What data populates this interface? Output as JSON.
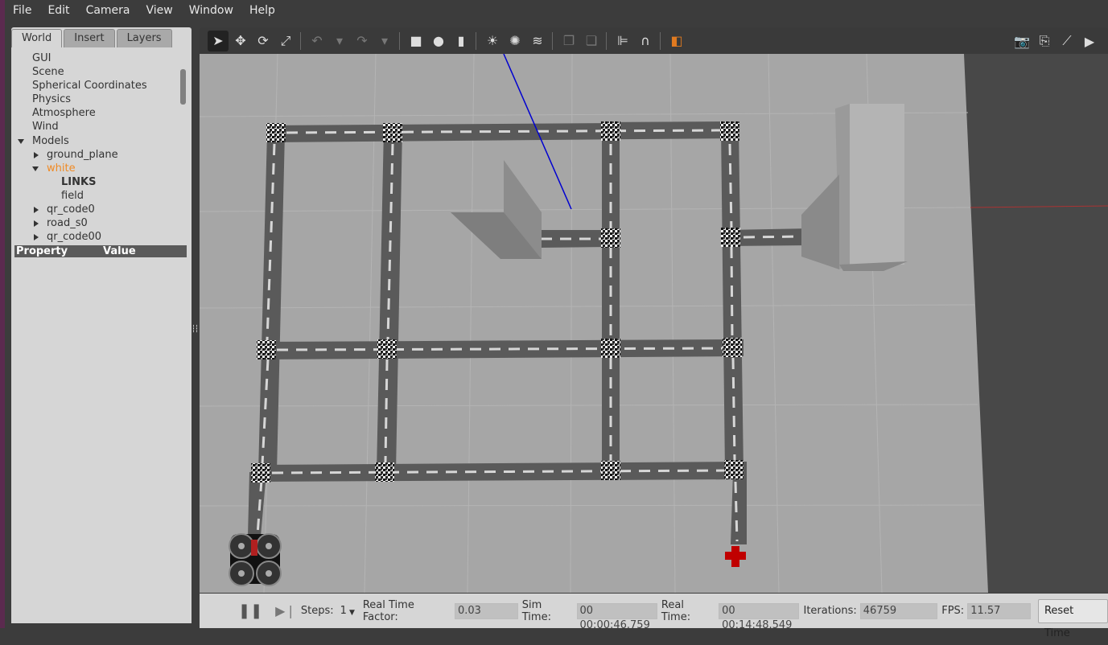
{
  "menubar": [
    "File",
    "Edit",
    "Camera",
    "View",
    "Window",
    "Help"
  ],
  "left_panel": {
    "tabs": [
      "World",
      "Insert",
      "Layers"
    ],
    "active_tab": 0,
    "tree": [
      {
        "label": "GUI",
        "indent": 0,
        "arrow": "none"
      },
      {
        "label": "Scene",
        "indent": 0,
        "arrow": "none"
      },
      {
        "label": "Spherical Coordinates",
        "indent": 0,
        "arrow": "none"
      },
      {
        "label": "Physics",
        "indent": 0,
        "arrow": "none"
      },
      {
        "label": "Atmosphere",
        "indent": 0,
        "arrow": "none"
      },
      {
        "label": "Wind",
        "indent": 0,
        "arrow": "none"
      },
      {
        "label": "Models",
        "indent": 0,
        "arrow": "down"
      },
      {
        "label": "ground_plane",
        "indent": 1,
        "arrow": "right"
      },
      {
        "label": "white",
        "indent": 1,
        "arrow": "down",
        "highlight": true
      },
      {
        "label": "LINKS",
        "indent": 2,
        "arrow": "none",
        "bold": true
      },
      {
        "label": "field",
        "indent": 2,
        "arrow": "none"
      },
      {
        "label": "qr_code0",
        "indent": 1,
        "arrow": "right"
      },
      {
        "label": "road_s0",
        "indent": 1,
        "arrow": "right"
      },
      {
        "label": "qr_code00",
        "indent": 1,
        "arrow": "right"
      }
    ],
    "property_header": {
      "property": "Property",
      "value": "Value"
    }
  },
  "toolbar": {
    "tools": [
      {
        "icon": "select-arrow-icon",
        "glyph": "➤",
        "selected": true
      },
      {
        "icon": "translate-icon",
        "glyph": "✥"
      },
      {
        "icon": "rotate-icon",
        "glyph": "⟳"
      },
      {
        "icon": "scale-icon",
        "glyph": "⤢"
      },
      {
        "sep": true
      },
      {
        "icon": "undo-icon",
        "glyph": "↶",
        "dim": true
      },
      {
        "icon": "undo-dropdown-icon",
        "glyph": "▾",
        "dim": true
      },
      {
        "icon": "redo-icon",
        "glyph": "↷",
        "dim": true
      },
      {
        "icon": "redo-dropdown-icon",
        "glyph": "▾",
        "dim": true
      },
      {
        "sep": true
      },
      {
        "icon": "box-shape-icon",
        "glyph": "■"
      },
      {
        "icon": "sphere-shape-icon",
        "glyph": "●"
      },
      {
        "icon": "cylinder-shape-icon",
        "glyph": "▮"
      },
      {
        "sep": true
      },
      {
        "icon": "point-light-icon",
        "glyph": "☀"
      },
      {
        "icon": "spot-light-icon",
        "glyph": "✺"
      },
      {
        "icon": "directional-light-icon",
        "glyph": "≋"
      },
      {
        "sep": true
      },
      {
        "icon": "copy-icon",
        "glyph": "❐",
        "dim": true
      },
      {
        "icon": "paste-icon",
        "glyph": "❏",
        "dim": true
      },
      {
        "sep": true
      },
      {
        "icon": "align-icon",
        "glyph": "⊫"
      },
      {
        "icon": "snap-magnet-icon",
        "glyph": "∩"
      },
      {
        "sep": true
      },
      {
        "icon": "view-angle-icon",
        "glyph": "◧",
        "color": "#e07a20"
      }
    ],
    "right_tools": [
      {
        "icon": "screenshot-camera-icon",
        "glyph": "📷"
      },
      {
        "icon": "log-icon",
        "glyph": "⎘"
      },
      {
        "icon": "plot-icon",
        "glyph": "⟋"
      },
      {
        "icon": "record-video-icon",
        "glyph": "▶"
      }
    ]
  },
  "bottom_bar": {
    "pause_icon": "pause-icon",
    "step_icon": "step-icon",
    "steps_label": "Steps:",
    "steps_value": "1",
    "rtf_label": "Real Time Factor:",
    "rtf_value": "0.03",
    "sim_time_label": "Sim Time:",
    "sim_time_value": "00 00:00:46.759",
    "real_time_label": "Real Time:",
    "real_time_value": "00 00:14:48.549",
    "iterations_label": "Iterations:",
    "iterations_value": "46759",
    "fps_label": "FPS:",
    "fps_value": "11.57",
    "reset_button": "Reset Time"
  },
  "colors": {
    "highlight": "#f08a24",
    "road": "#5a5a5a",
    "ground": "#a6a6a6",
    "sky": "#484848",
    "target": "#c00000",
    "laser": "#0000d0"
  }
}
